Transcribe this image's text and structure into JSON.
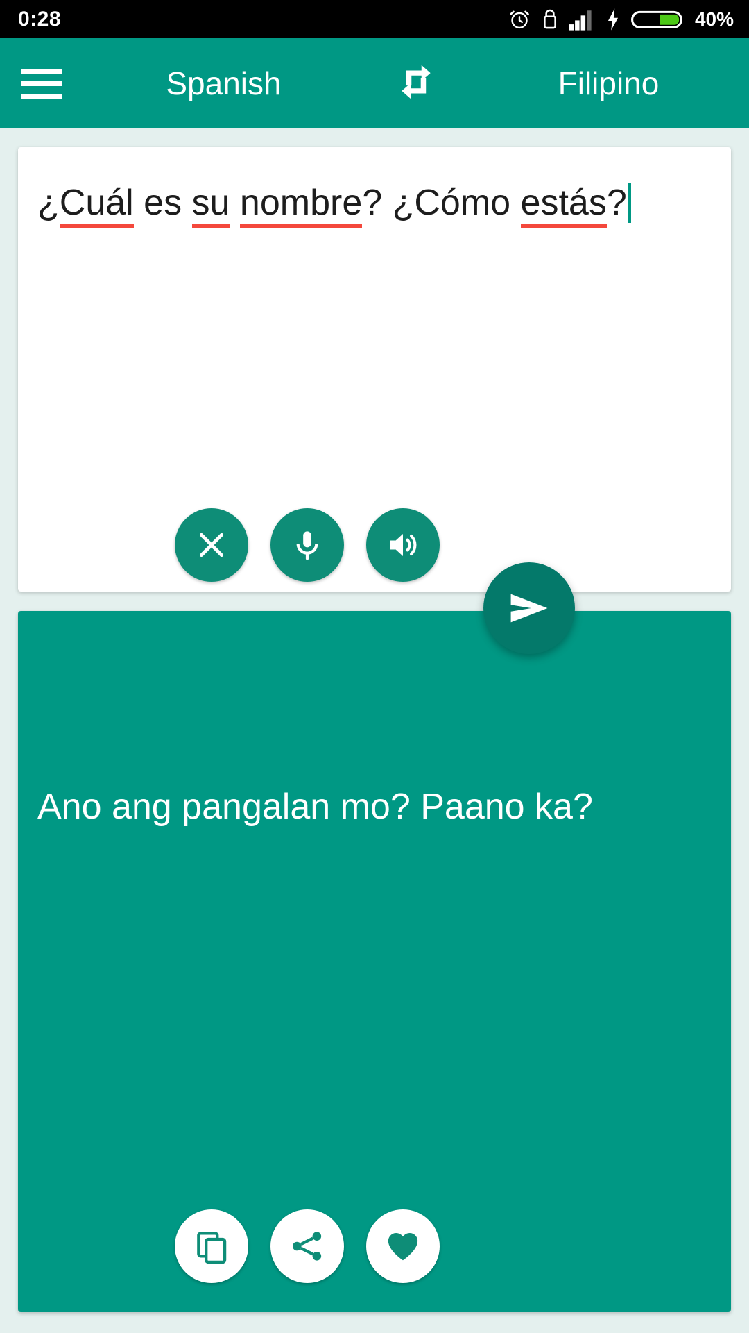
{
  "status_bar": {
    "time": "0:28",
    "battery_percent": "40%",
    "icons": [
      "alarm-clock-icon",
      "lock-icon",
      "signal-bars-icon",
      "charging-bolt-icon",
      "battery-icon"
    ],
    "battery_level": 40,
    "background_color": "#000000",
    "text_color": "#ffffff",
    "battery_fill_color": "#4dc917"
  },
  "app_bar": {
    "menu_label": "menu",
    "source_language": "Spanish",
    "swap_label": "swap languages",
    "target_language": "Filipino",
    "background_color": "#009884",
    "text_color": "#ffffff"
  },
  "input_card": {
    "text": "¿Cuál es su nombre? ¿Cómo estás?",
    "segments": [
      {
        "text": "¿",
        "misspelled": false
      },
      {
        "text": "Cuál",
        "misspelled": true
      },
      {
        "text": " es ",
        "misspelled": false
      },
      {
        "text": "su",
        "misspelled": true
      },
      {
        "text": " ",
        "misspelled": false
      },
      {
        "text": "nombre",
        "misspelled": true
      },
      {
        "text": "? ¿",
        "misspelled": false
      },
      {
        "text": "Cómo",
        "misspelled": false
      },
      {
        "text": " ",
        "misspelled": false
      },
      {
        "text": "estás",
        "misspelled": true
      },
      {
        "text": "?",
        "misspelled": false
      }
    ],
    "caret_visible": true,
    "spellcheck_underline_color": "#f4483c",
    "background_color": "#ffffff",
    "text_color": "#1d1d1d",
    "actions": [
      {
        "name": "clear-button",
        "icon": "close-icon",
        "label": "Clear"
      },
      {
        "name": "microphone-button",
        "icon": "microphone-icon",
        "label": "Voice input"
      },
      {
        "name": "speak-source-button",
        "icon": "speaker-icon",
        "label": "Listen"
      }
    ]
  },
  "send_button": {
    "name": "send-button",
    "icon": "send-icon",
    "label": "Translate",
    "background_color": "#04796a"
  },
  "output_card": {
    "text": "Ano ang pangalan mo? Paano ka?",
    "background_color": "#009884",
    "text_color": "#ffffff",
    "actions": [
      {
        "name": "copy-button",
        "icon": "copy-icon",
        "label": "Copy"
      },
      {
        "name": "share-button",
        "icon": "share-icon",
        "label": "Share"
      },
      {
        "name": "favorite-button",
        "icon": "heart-icon",
        "label": "Favorite"
      }
    ]
  },
  "page_background_color": "#e4f0ee"
}
